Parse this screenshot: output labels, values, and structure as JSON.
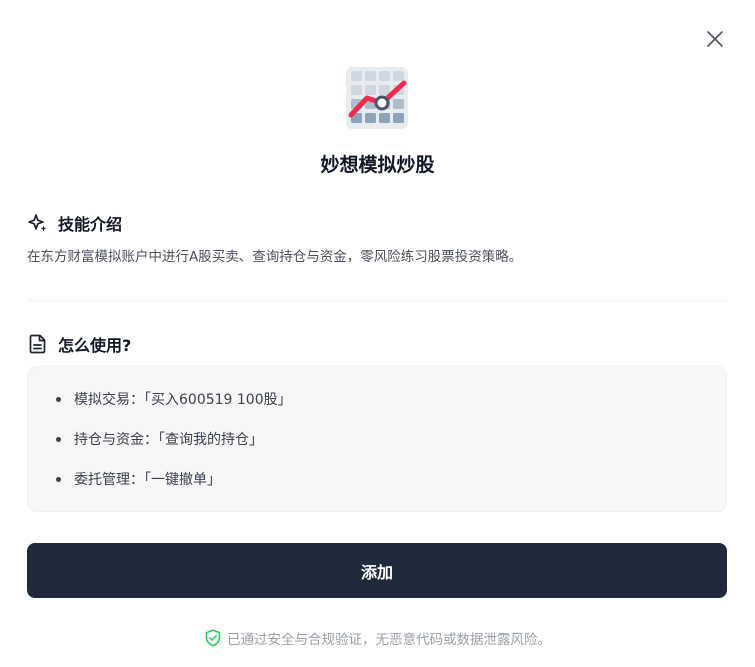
{
  "skill": {
    "title": "妙想模拟炒股",
    "icon": "stock-chart-grid-icon"
  },
  "close": {
    "icon": "close-icon"
  },
  "intro": {
    "heading": "技能介绍",
    "icon": "sparkle-icon",
    "text": "在东方财富模拟账户中进行A股买卖、查询持仓与资金，零风险练习股票投资策略。"
  },
  "usage": {
    "heading": "怎么使用?",
    "icon": "document-icon",
    "items": [
      {
        "label": "模拟交易：「买入600519 100股」"
      },
      {
        "label": "持仓与资金：「查询我的持仓」"
      },
      {
        "label": "委托管理：「一键撤单」"
      }
    ]
  },
  "actions": {
    "add_label": "添加"
  },
  "security": {
    "icon": "shield-check-icon",
    "text": "已通过安全与合规验证，无恶意代码或数据泄露风险。"
  },
  "colors": {
    "primary_button": "#1f2a3d",
    "chart_line": "#f0294e",
    "shield": "#34c759",
    "muted_text": "#9aa0ab"
  }
}
